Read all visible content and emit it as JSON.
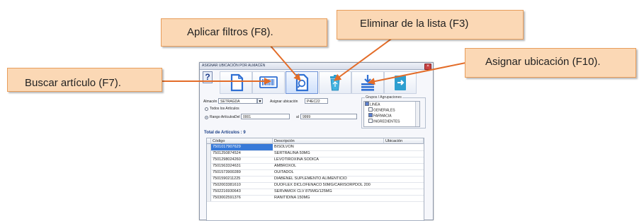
{
  "window": {
    "title": "ASIGNAR UBICACIÓN POR ALMACÉN",
    "close_glyph": "×"
  },
  "help_label": "?",
  "toolbar": {
    "buttons": [
      {
        "icon": "new-document-icon"
      },
      {
        "icon": "barcode-icon"
      },
      {
        "icon": "search-document-icon"
      },
      {
        "icon": "trash-icon"
      },
      {
        "icon": "assign-location-icon"
      },
      {
        "icon": "exit-icon"
      }
    ]
  },
  "form": {
    "almacen_label": "Almacén",
    "almacen_value": "SETRAGDA",
    "asignar_label": "Asignar ubicación",
    "asignar_value": "P4EC22",
    "todos_label": "Todos los Artículos",
    "rango_label": "Rango Artículos",
    "del_label": "Del",
    "del_value": "0001",
    "al_label": "al",
    "al_value": "9999"
  },
  "grupos": {
    "title": "Grupos / Agrupaciones",
    "items": [
      "LINEA",
      "GENERALES",
      "FARMACIA",
      "INGREDIENTES"
    ]
  },
  "total_label": "Total de Artículos : 9",
  "table": {
    "headers": [
      "Código",
      "Descripción",
      "Ubicación"
    ],
    "rows": [
      [
        "7501017907629",
        "BISOLVON"
      ],
      [
        "7501250874524",
        "SERTRALINA 50MG"
      ],
      [
        "7501298024260",
        "LEVOTIROXINA SODICA"
      ],
      [
        "7501563324631",
        "AMBROXOL"
      ],
      [
        "7501573900289",
        "OUITADOL"
      ],
      [
        "7501590211225",
        "DIABENEL SUPLEMENTO ALIMENTICIO"
      ],
      [
        "7502003381610",
        "DUOFLEX DICLOFENACO 50MG/CARISORPDOL 200"
      ],
      [
        "7502216930643",
        "SERVAMOX CLV 875MG/125MG"
      ],
      [
        "7503002591376",
        "RANITIDINA 150MG"
      ]
    ]
  },
  "callouts": {
    "buscar": "Buscar artículo (F7).",
    "aplicar": "Aplicar filtros (F8).",
    "eliminar": "Eliminar de la lista (F3)",
    "asignar": "Asignar ubicación (F10)."
  },
  "colors": {
    "callout_fill": "#fbd8b5",
    "callout_border": "#e89d5b",
    "selection": "#3779d8"
  }
}
